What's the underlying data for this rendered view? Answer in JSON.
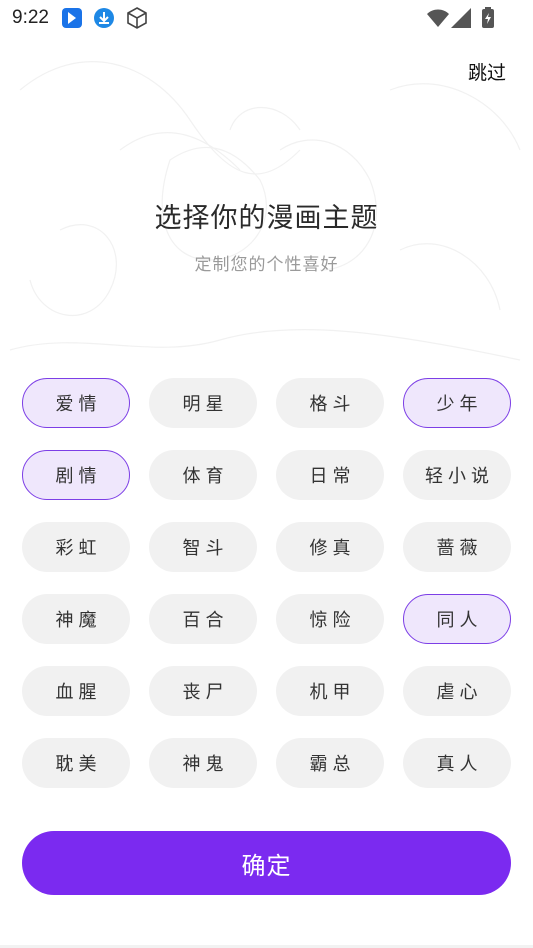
{
  "status": {
    "time": "9:22",
    "icons": [
      "app-badge-icon",
      "download-icon",
      "cube-icon",
      "wifi-icon",
      "signal-icon",
      "battery-icon"
    ]
  },
  "header": {
    "skip_label": "跳过"
  },
  "main": {
    "title": "选择你的漫画主题",
    "subtitle": "定制您的个性喜好"
  },
  "tags": [
    {
      "label": "爱情",
      "selected": true
    },
    {
      "label": "明星",
      "selected": false
    },
    {
      "label": "格斗",
      "selected": false
    },
    {
      "label": "少年",
      "selected": true
    },
    {
      "label": "剧情",
      "selected": true
    },
    {
      "label": "体育",
      "selected": false
    },
    {
      "label": "日常",
      "selected": false
    },
    {
      "label": "轻小说",
      "selected": false
    },
    {
      "label": "彩虹",
      "selected": false
    },
    {
      "label": "智斗",
      "selected": false
    },
    {
      "label": "修真",
      "selected": false
    },
    {
      "label": "蔷薇",
      "selected": false
    },
    {
      "label": "神魔",
      "selected": false
    },
    {
      "label": "百合",
      "selected": false
    },
    {
      "label": "惊险",
      "selected": false
    },
    {
      "label": "同人",
      "selected": true
    },
    {
      "label": "血腥",
      "selected": false
    },
    {
      "label": "丧尸",
      "selected": false
    },
    {
      "label": "机甲",
      "selected": false
    },
    {
      "label": "虐心",
      "selected": false
    },
    {
      "label": "耽美",
      "selected": false
    },
    {
      "label": "神鬼",
      "selected": false
    },
    {
      "label": "霸总",
      "selected": false
    },
    {
      "label": "真人",
      "selected": false
    }
  ],
  "footer": {
    "confirm_label": "确定"
  },
  "colors": {
    "accent": "#7b2af0",
    "selected_bg": "#efe7fc",
    "tag_bg": "#f1f1f1"
  }
}
